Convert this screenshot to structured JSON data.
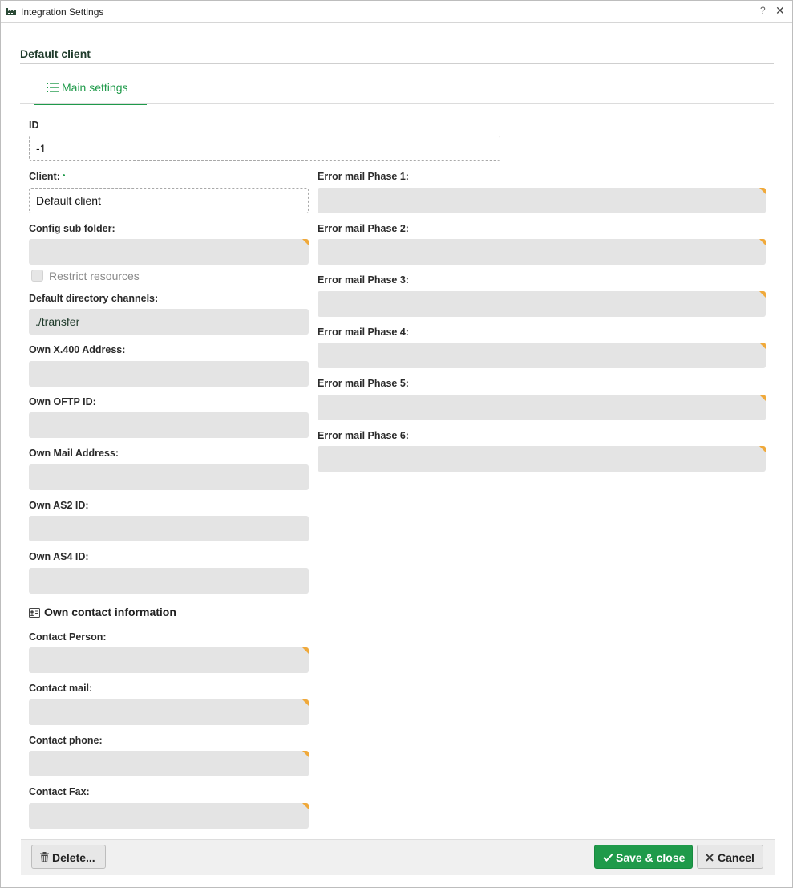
{
  "window": {
    "title": "Integration Settings",
    "help_glyph": "?",
    "close_glyph": "✕",
    "app_icon": "factory-icon"
  },
  "section": {
    "title": "Default client"
  },
  "tabs": [
    {
      "label": "Main settings",
      "icon": "list-icon",
      "active": true
    }
  ],
  "form": {
    "id": {
      "label": "ID",
      "value": "-1"
    },
    "client": {
      "label": "Client:",
      "required_marker": "•",
      "value": "Default client"
    },
    "config_sub_folder": {
      "label": "Config sub folder:",
      "value": ""
    },
    "restrict_resources": {
      "label": "Restrict resources",
      "checked": false
    },
    "default_directory_channels": {
      "label": "Default directory channels:",
      "value": "./transfer"
    },
    "own_x400_address": {
      "label": "Own X.400 Address:",
      "value": ""
    },
    "own_oftp_id": {
      "label": "Own OFTP ID:",
      "value": ""
    },
    "own_mail_address": {
      "label": "Own Mail Address:",
      "value": ""
    },
    "own_as2_id": {
      "label": "Own AS2 ID:",
      "value": ""
    },
    "own_as4_id": {
      "label": "Own AS4 ID:",
      "value": ""
    },
    "contact": {
      "heading": "Own contact information",
      "heading_icon": "contact-card-icon",
      "person": {
        "label": "Contact Person:",
        "value": ""
      },
      "mail": {
        "label": "Contact mail:",
        "value": ""
      },
      "phone": {
        "label": "Contact phone:",
        "value": ""
      },
      "fax": {
        "label": "Contact Fax:",
        "value": ""
      }
    },
    "error_mail": [
      {
        "label": "Error mail Phase 1:",
        "value": ""
      },
      {
        "label": "Error mail Phase 2:",
        "value": ""
      },
      {
        "label": "Error mail Phase 3:",
        "value": ""
      },
      {
        "label": "Error mail Phase 4:",
        "value": ""
      },
      {
        "label": "Error mail Phase 5:",
        "value": ""
      },
      {
        "label": "Error mail Phase 6:",
        "value": ""
      }
    ]
  },
  "footer": {
    "delete_label": "Delete...",
    "save_label": "Save & close",
    "cancel_label": "Cancel"
  },
  "colors": {
    "accent": "#1f9a4a",
    "field_flag": "#f0a93a",
    "field_bg": "#e4e4e4"
  }
}
